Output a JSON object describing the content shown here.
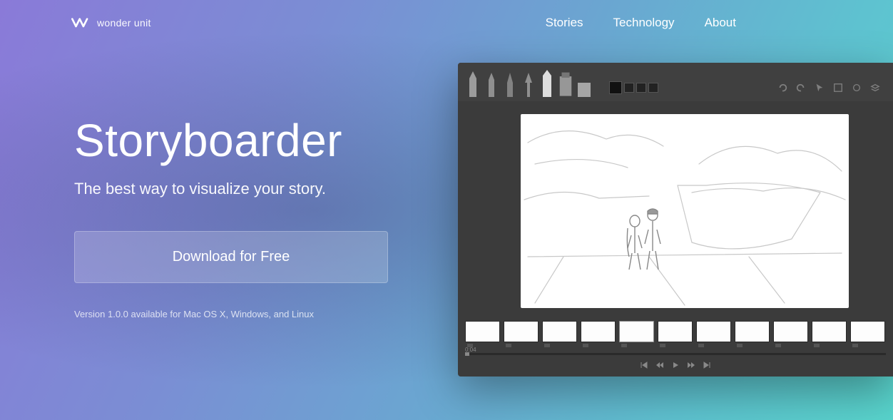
{
  "brand": {
    "name": "wonder unit"
  },
  "nav": {
    "stories": "Stories",
    "technology": "Technology",
    "about": "About"
  },
  "hero": {
    "title": "Storyboarder",
    "subtitle": "The best way to visualize your story.",
    "download_label": "Download for Free",
    "version_note": "Version 1.0.0 available for Mac OS X, Windows, and Linux"
  },
  "app": {
    "timeline_pos": "0:04",
    "thumb_count": 11,
    "selected_thumb": 4
  }
}
